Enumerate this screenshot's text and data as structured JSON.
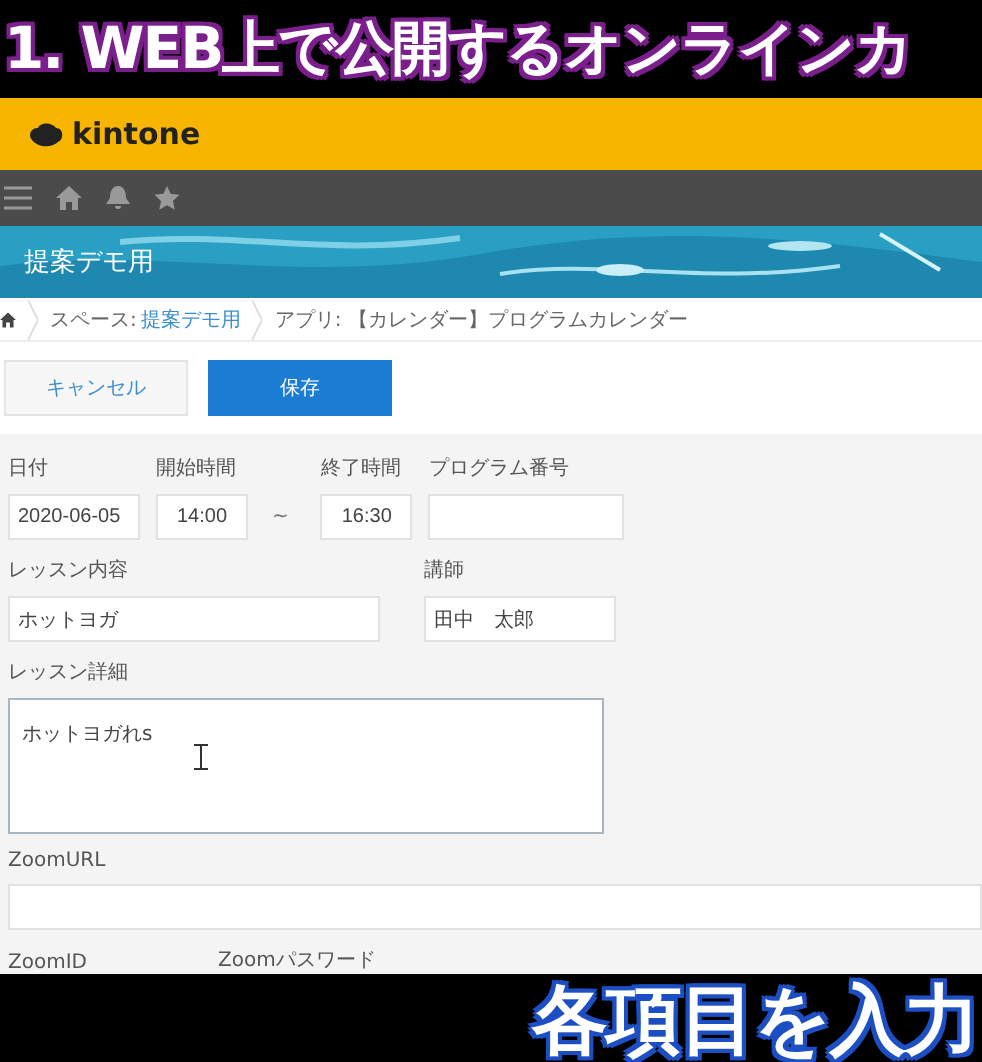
{
  "caption_top": "1. WEB上で公開するオンラインカ",
  "header": {
    "logo": "kintone"
  },
  "banner": {
    "title": "提案デモ用"
  },
  "breadcrumb": {
    "space_label": "スペース:",
    "space_link": "提案デモ用",
    "app": "アプリ: 【カレンダー】プログラムカレンダー"
  },
  "buttons": [
    {
      "label": "キャンセル",
      "kind": "secondary"
    },
    {
      "label": "保存",
      "kind": "primary"
    }
  ],
  "form": {
    "rows": [
      {
        "fields": [
          {
            "kind": "date",
            "label": "日付",
            "value": "2020-06-05"
          },
          {
            "kind": "time",
            "label": "開始時間",
            "value": "14:00"
          },
          {
            "kind": "separator",
            "text": "~"
          },
          {
            "kind": "time",
            "label": "終了時間",
            "value": "16:30"
          },
          {
            "kind": "code",
            "label": "プログラム番号"
          }
        ]
      },
      {
        "fields": [
          {
            "kind": "wide",
            "label": "レッスン内容",
            "value": "ホットヨガ"
          },
          {
            "kind": "name",
            "label": "講師",
            "value": "田中　太郎"
          }
        ]
      },
      {
        "fields": [
          {
            "kind": "textarea",
            "label": "レッスン詳細",
            "value": "ホットヨガれs"
          }
        ]
      },
      {
        "fields": [
          {
            "kind": "url",
            "label": "ZoomURL"
          }
        ]
      },
      {
        "fields": [
          {
            "kind": "cut",
            "label": "ZoomID"
          },
          {
            "kind": "cut",
            "label": "Zoomパスワード"
          }
        ]
      }
    ]
  },
  "caption_bottom": "各項目を入力"
}
